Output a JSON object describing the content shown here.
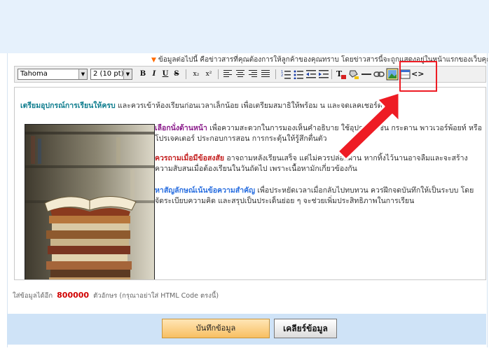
{
  "notice": "ข้อมูลต่อไปนี้ คือข่าวสารที่คุณต้องการให้ลูกค้าของคุณทราบ โดยข่าวสารนี้จะถูกแสดงอยู่ในหน้าแรกของเว็บคุณด้วย",
  "toolbar": {
    "font": "Tahoma",
    "size": "2 (10 pt)",
    "bold": "B",
    "italic": "I",
    "underline": "U",
    "strike": "S",
    "subscript": "x₂",
    "superscript": "x²",
    "html_source": "<>"
  },
  "content": {
    "p1_highlight": "เตรียมอุปกรณ์การเรียนให้ครบ",
    "p1_text": " และควรเข้าห้องเรียนก่อนเวลาเล็กน้อย เพื่อเตรียมสมาธิให้พร้อม                                                     น และจดเลคเชอร์ตาม",
    "p2_highlight": "เลือกนั่งด้านหน้า",
    "p2_text": " เพื่อความสะดวกในการมองเห็นคำอธิบาย                    ใช้อุปกรณ์ เช่น กระดาน พาวเวอร์พ้อยท์ หรือโปรเจคเตอร์ ประกอบการสอน              การกระตุ้นให้รู้สึกตื่นตัว",
    "p3_highlight": "ควรถามเมื่อมีข้อสงสัย",
    "p3_text": " อาจถามหลังเรียนเสร็จ แต่ไม่ควรปล่อยผ่าน หากทิ้งไว้นานอาจลืมและจะสร้างความสับสนเมื่อต้องเรียนในวันถัดไป เพราะเนื้อหามักเกี่ยวข้องกัน",
    "p4_highlight": "หาสัญลักษณ์เน้นข้อความสำคัญ",
    "p4_text": " เพื่อประหยัดเวลาเมื่อกลับไปทบทวน ควรฝึกจดบันทึกให้เป็นระบบ โดยจัดระเบียบความคิด และสรุปเป็นประเด็นย่อย ๆ จะช่วยเพิ่มประสิทธิภาพในการเรียน"
  },
  "char_info": {
    "prefix": "ใส่ข้อมูลได้อีก",
    "count": "800000",
    "suffix": "ตัวอักษร (กรุณาอย่าใส่ HTML Code ตรงนี้)"
  },
  "buttons": {
    "save": "บันทึกข้อมูล",
    "clear": "เคลียร์ข้อมูล"
  },
  "colors": {
    "highlight_box": "#ee1c24",
    "arrow": "#ee1c24",
    "char_count": "#d10000",
    "save_button": "#f8bf62",
    "bottom_bar": "#cfe3f7"
  }
}
